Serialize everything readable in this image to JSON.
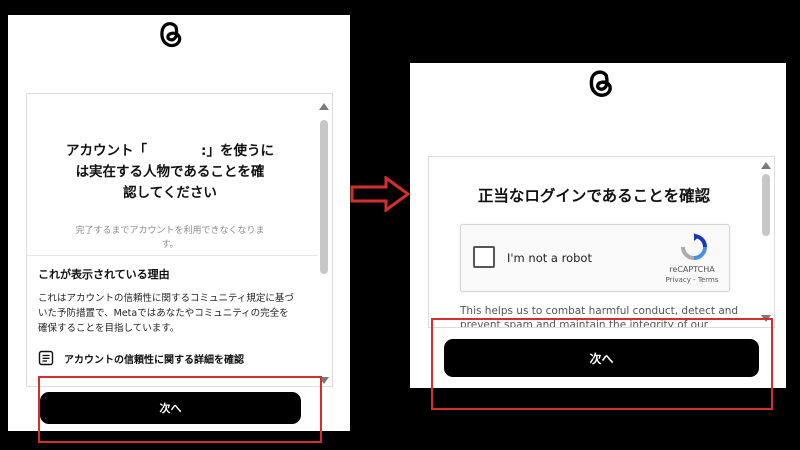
{
  "left": {
    "title_lines": [
      "アカウント「　　　　:」を使うに",
      "は実在する人物であることを確",
      "認してください"
    ],
    "subtitle_lines": [
      "完了するまでアカウントを利用できなくなりま",
      "す。"
    ],
    "reason_title": "これが表示されている理由",
    "reason_lines": [
      "これはアカウントの信頼性に関するコミュニティ規定に基づ",
      "いた予防措置で、Metaではあなたやコミュニティの完全を",
      "確保することを目指しています。"
    ],
    "link_text": "アカウントの信頼性に関する詳細を確認",
    "next_button": "次へ"
  },
  "right": {
    "title": "正当なログインであることを確認",
    "recaptcha": {
      "label": "I'm not a robot",
      "brand": "reCAPTCHA",
      "links": "Privacy - Terms"
    },
    "help_lines": [
      "This helps us to combat harmful conduct, detect and",
      "prevent spam and maintain the integrity of our Products."
    ],
    "next_button": "次へ"
  },
  "colors": {
    "highlight": "#d32f2f",
    "background": "#000000",
    "button": "#000000"
  }
}
